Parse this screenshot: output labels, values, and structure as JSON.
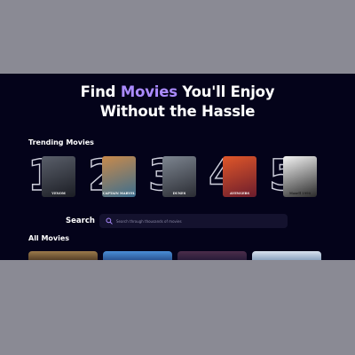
{
  "hero": {
    "title_prefix": "Find ",
    "title_accent": "Movies",
    "title_suffix": " You'll Enjoy",
    "title_line2": "Without the Hassle"
  },
  "trending": {
    "heading": "Trending Movies",
    "items": [
      {
        "rank": "1",
        "caption": "VENOM",
        "poster_colors": [
          "#5a5f6a",
          "#1b1d24"
        ]
      },
      {
        "rank": "2",
        "caption": "CAPTAIN MARVEL",
        "poster_colors": [
          "#c98a4b",
          "#3b6e8f"
        ]
      },
      {
        "rank": "3",
        "caption": "DUNES",
        "poster_colors": [
          "#7d8590",
          "#2a2c33"
        ]
      },
      {
        "rank": "4",
        "caption": "AVENGERS",
        "poster_colors": [
          "#e0572a",
          "#6b1c2c"
        ]
      },
      {
        "rank": "5",
        "caption": "Maxell 1990",
        "poster_colors": [
          "#f4f4f4",
          "#2b2b2b"
        ]
      }
    ]
  },
  "search": {
    "label": "Search",
    "placeholder": "Search through thousands of movies",
    "icon": "search-icon"
  },
  "all_movies": {
    "heading": "All Movies",
    "cards": [
      {
        "colors": [
          "#9b7a4b",
          "#3b2a1a"
        ]
      },
      {
        "colors": [
          "#4a8fd6",
          "#1e3f7a"
        ]
      },
      {
        "colors": [
          "#4b2d4a",
          "#1b1533"
        ]
      },
      {
        "colors": [
          "#d8e2ee",
          "#6f8cae"
        ]
      }
    ]
  },
  "colors": {
    "page_bg": "#04031a",
    "accent": "#ab8bff",
    "outer_bg": "#8a8a94"
  }
}
